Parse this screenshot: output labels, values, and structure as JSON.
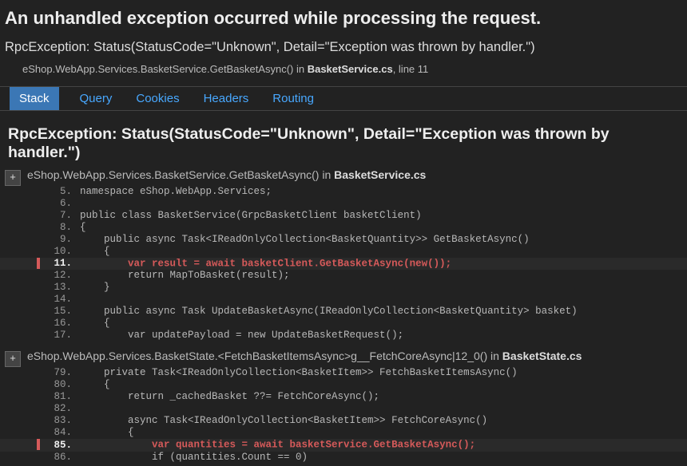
{
  "title": "An unhandled exception occurred while processing the request.",
  "exception_summary": "RpcException: Status(StatusCode=\"Unknown\", Detail=\"Exception was thrown by handler.\")",
  "top_frame": {
    "method": "eShop.WebApp.Services.BasketService.GetBasketAsync() in ",
    "file": "BasketService.cs",
    "suffix": ", line 11"
  },
  "tabs": [
    "Stack",
    "Query",
    "Cookies",
    "Headers",
    "Routing"
  ],
  "active_tab": "Stack",
  "section_heading": "RpcException: Status(StatusCode=\"Unknown\", Detail=\"Exception was thrown by handler.\")",
  "frames": [
    {
      "header_method": "eShop.WebApp.Services.BasketService.GetBasketAsync() in ",
      "header_file": "BasketService.cs",
      "expand_label": "+",
      "highlight_line": 11,
      "lines": [
        {
          "n": 5,
          "t": "namespace eShop.WebApp.Services;"
        },
        {
          "n": 6,
          "t": ""
        },
        {
          "n": 7,
          "t": "public class BasketService(GrpcBasketClient basketClient)"
        },
        {
          "n": 8,
          "t": "{"
        },
        {
          "n": 9,
          "t": "    public async Task<IReadOnlyCollection<BasketQuantity>> GetBasketAsync()"
        },
        {
          "n": 10,
          "t": "    {"
        },
        {
          "n": 11,
          "t": "        var result = await basketClient.GetBasketAsync(new());"
        },
        {
          "n": 12,
          "t": "        return MapToBasket(result);"
        },
        {
          "n": 13,
          "t": "    }"
        },
        {
          "n": 14,
          "t": ""
        },
        {
          "n": 15,
          "t": "    public async Task UpdateBasketAsync(IReadOnlyCollection<BasketQuantity> basket)"
        },
        {
          "n": 16,
          "t": "    {"
        },
        {
          "n": 17,
          "t": "        var updatePayload = new UpdateBasketRequest();"
        }
      ]
    },
    {
      "header_method": "eShop.WebApp.Services.BasketState.<FetchBasketItemsAsync>g__FetchCoreAsync|12_0() in ",
      "header_file": "BasketState.cs",
      "expand_label": "+",
      "highlight_line": 85,
      "lines": [
        {
          "n": 79,
          "t": "    private Task<IReadOnlyCollection<BasketItem>> FetchBasketItemsAsync()"
        },
        {
          "n": 80,
          "t": "    {"
        },
        {
          "n": 81,
          "t": "        return _cachedBasket ??= FetchCoreAsync();"
        },
        {
          "n": 82,
          "t": ""
        },
        {
          "n": 83,
          "t": "        async Task<IReadOnlyCollection<BasketItem>> FetchCoreAsync()"
        },
        {
          "n": 84,
          "t": "        {"
        },
        {
          "n": 85,
          "t": "            var quantities = await basketService.GetBasketAsync();"
        },
        {
          "n": 86,
          "t": "            if (quantities.Count == 0)"
        }
      ]
    }
  ]
}
